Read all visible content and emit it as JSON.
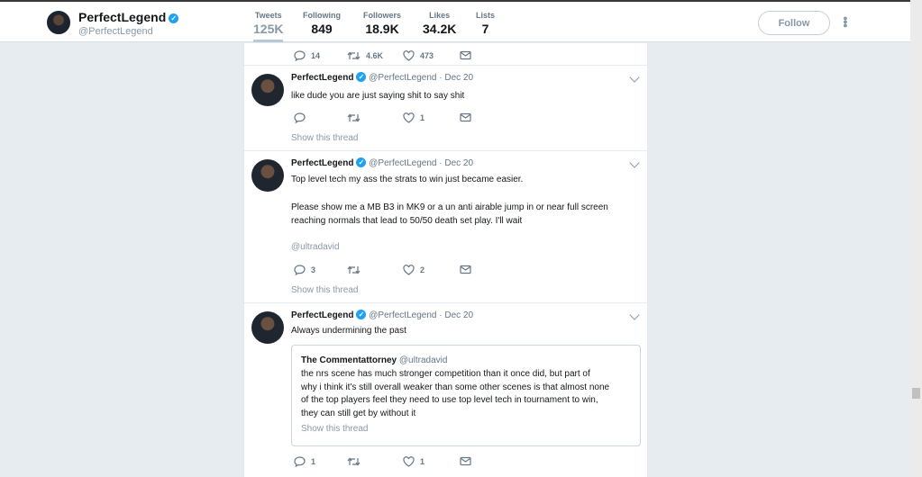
{
  "profile": {
    "name": "PerfectLegend",
    "handle": "@PerfectLegend",
    "stats": [
      {
        "label": "Tweets",
        "value": "125K"
      },
      {
        "label": "Following",
        "value": "849"
      },
      {
        "label": "Followers",
        "value": "18.9K"
      },
      {
        "label": "Likes",
        "value": "34.2K"
      },
      {
        "label": "Lists",
        "value": "7"
      }
    ],
    "follow_label": "Follow"
  },
  "top_actions": {
    "replies": "14",
    "retweets": "4.6K",
    "likes": "473"
  },
  "tweets": [
    {
      "name": "PerfectLegend",
      "handle": "@PerfectLegend",
      "date": "· Dec 20",
      "text": "like dude you are just saying shit to say shit",
      "replies": "",
      "retweets": "",
      "likes": "1",
      "show_thread": "Show this thread"
    },
    {
      "name": "PerfectLegend",
      "handle": "@PerfectLegend",
      "date": "· Dec 20",
      "text_1": "Top level tech my ass the strats to win just became easier.",
      "text_2": "Please show me a MB B3 in MK9 or a un anti airable jump in or near full screen",
      "text_3": "reaching normals that lead to 50/50 death set play. I'll wait",
      "mention": "@ultradavid",
      "replies": "3",
      "retweets": "",
      "likes": "2",
      "show_thread": "Show this thread"
    },
    {
      "name": "PerfectLegend",
      "handle": "@PerfectLegend",
      "date": "· Dec 20",
      "text": "Always undermining the past",
      "quote": {
        "name": "The Commentattorney",
        "handle": "@ultradavid",
        "lines": [
          "the nrs scene has much stronger competition than it once did, but part of",
          "why i think it's still overall weaker than some other scenes is that almost none",
          "of the top players feel they need to use top level tech in tournament to win,",
          "they can still get by without it"
        ],
        "show_thread": "Show this thread"
      },
      "replies": "1",
      "retweets": "",
      "likes": "1"
    }
  ],
  "colors": {
    "accent": "#1da1f2",
    "muted": "#657786",
    "background": "#e6ecf0"
  }
}
